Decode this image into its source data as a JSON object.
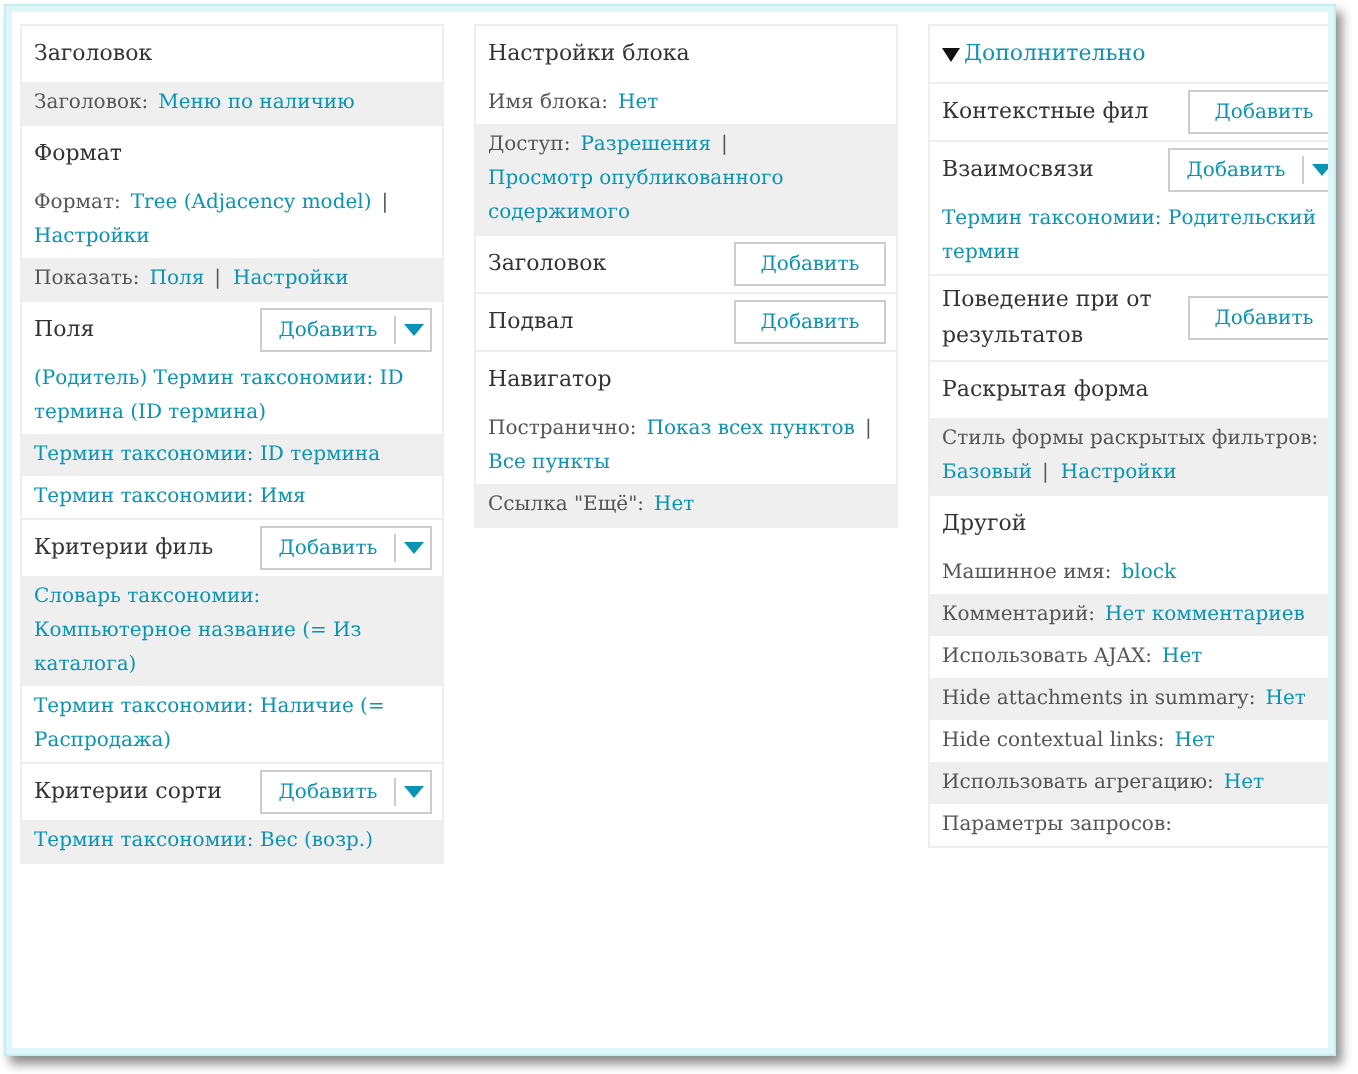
{
  "columns": [
    {
      "sections": [
        {
          "title": "Заголовок",
          "rows": [
            {
              "shaded": true,
              "label": "Заголовок:",
              "parts": [
                {
                  "kind": "link",
                  "text": "Меню по наличию"
                }
              ]
            }
          ]
        },
        {
          "title": "Формат",
          "rows": [
            {
              "shaded": false,
              "label": "Формат:",
              "parts": [
                {
                  "kind": "link",
                  "text": "Tree (Adjacency model)"
                },
                {
                  "kind": "sep",
                  "text": "|"
                },
                {
                  "kind": "link",
                  "text": "Настройки"
                }
              ]
            },
            {
              "shaded": true,
              "label": "Показать:",
              "parts": [
                {
                  "kind": "link",
                  "text": "Поля"
                },
                {
                  "kind": "sep",
                  "text": "|"
                },
                {
                  "kind": "link",
                  "text": "Настройки"
                }
              ]
            }
          ]
        },
        {
          "title": "Поля",
          "button": {
            "kind": "split",
            "label": "Добавить"
          },
          "rows": [
            {
              "shaded": false,
              "parts": [
                {
                  "kind": "link",
                  "text": "(Родитель) Термин таксономии: ID термина (ID термина)"
                }
              ]
            },
            {
              "shaded": true,
              "parts": [
                {
                  "kind": "link",
                  "text": "Термин таксономии: ID термина"
                }
              ]
            },
            {
              "shaded": false,
              "parts": [
                {
                  "kind": "link",
                  "text": "Термин таксономии: Имя"
                }
              ]
            }
          ]
        },
        {
          "title": "Критерии филь",
          "button": {
            "kind": "split",
            "label": "Добавить"
          },
          "rows": [
            {
              "shaded": true,
              "parts": [
                {
                  "kind": "link",
                  "text": "Словарь таксономии: Компьютерное название (= Из каталога)"
                }
              ]
            },
            {
              "shaded": false,
              "parts": [
                {
                  "kind": "link",
                  "text": "Термин таксономии: Наличие (= Распродажа)"
                }
              ]
            }
          ]
        },
        {
          "title": "Критерии сорти",
          "button": {
            "kind": "split",
            "label": "Добавить"
          },
          "rows": [
            {
              "shaded": true,
              "parts": [
                {
                  "kind": "link",
                  "text": "Термин таксономии: Вес (возр.)"
                }
              ]
            }
          ]
        }
      ]
    },
    {
      "sections": [
        {
          "title": "Настройки блока",
          "rows": [
            {
              "shaded": false,
              "label": "Имя блока:",
              "parts": [
                {
                  "kind": "link",
                  "text": "Нет"
                }
              ]
            },
            {
              "shaded": true,
              "label": "Доступ:",
              "parts": [
                {
                  "kind": "link",
                  "text": "Разрешения"
                },
                {
                  "kind": "sep",
                  "text": "|"
                },
                {
                  "kind": "link",
                  "text": "Просмотр опубликованного содержимого"
                }
              ]
            }
          ]
        },
        {
          "title": "Заголовок",
          "button": {
            "kind": "plain",
            "label": "Добавить"
          }
        },
        {
          "title": "Подвал",
          "button": {
            "kind": "plain",
            "label": "Добавить"
          }
        },
        {
          "title": "Навигатор",
          "rows": [
            {
              "shaded": false,
              "label": "Постранично:",
              "parts": [
                {
                  "kind": "link",
                  "text": "Показ всех пунктов"
                },
                {
                  "kind": "sep",
                  "text": "|"
                },
                {
                  "kind": "link",
                  "text": "Все пункты"
                }
              ]
            },
            {
              "shaded": true,
              "label": "Ссылка \"Ещё\":",
              "parts": [
                {
                  "kind": "link",
                  "text": "Нет"
                }
              ]
            }
          ]
        }
      ]
    },
    {
      "sections": [
        {
          "title": "Дополнительно",
          "expanded": true
        },
        {
          "title": "Контекстные фил",
          "button": {
            "kind": "plain",
            "label": "Добавить"
          }
        },
        {
          "title": "Взаимосвязи",
          "button": {
            "kind": "split",
            "label": "Добавить"
          },
          "rows": [
            {
              "shaded": false,
              "parts": [
                {
                  "kind": "link",
                  "text": "Термин таксономии: Родительский термин"
                }
              ]
            }
          ]
        },
        {
          "title": "Поведение при от результатов",
          "button": {
            "kind": "plain",
            "label": "Добавить"
          }
        },
        {
          "title": "Раскрытая форма",
          "rows": [
            {
              "shaded": true,
              "label": "Стиль формы раскрытых фильтров:",
              "parts": [
                {
                  "kind": "link",
                  "text": "Базовый"
                },
                {
                  "kind": "sep",
                  "text": "|"
                },
                {
                  "kind": "link",
                  "text": "Настройки"
                }
              ]
            }
          ]
        },
        {
          "title": "Другой",
          "rows": [
            {
              "shaded": false,
              "label": "Машинное имя:",
              "parts": [
                {
                  "kind": "link",
                  "text": "block"
                }
              ]
            },
            {
              "shaded": true,
              "label": "Комментарий:",
              "parts": [
                {
                  "kind": "link",
                  "text": "Нет комментариев"
                }
              ]
            },
            {
              "shaded": false,
              "label": "Использовать AJAX:",
              "parts": [
                {
                  "kind": "link",
                  "text": "Нет"
                }
              ]
            },
            {
              "shaded": true,
              "label": "Hide attachments in summary:",
              "parts": [
                {
                  "kind": "link",
                  "text": "Нет"
                }
              ]
            },
            {
              "shaded": false,
              "label": "Hide contextual links:",
              "parts": [
                {
                  "kind": "link",
                  "text": "Нет"
                }
              ]
            },
            {
              "shaded": true,
              "label": "Использовать агрегацию:",
              "parts": [
                {
                  "kind": "link",
                  "text": "Нет"
                }
              ]
            },
            {
              "shaded": false,
              "label": "Параметры запросов:",
              "parts": []
            }
          ]
        }
      ]
    }
  ]
}
